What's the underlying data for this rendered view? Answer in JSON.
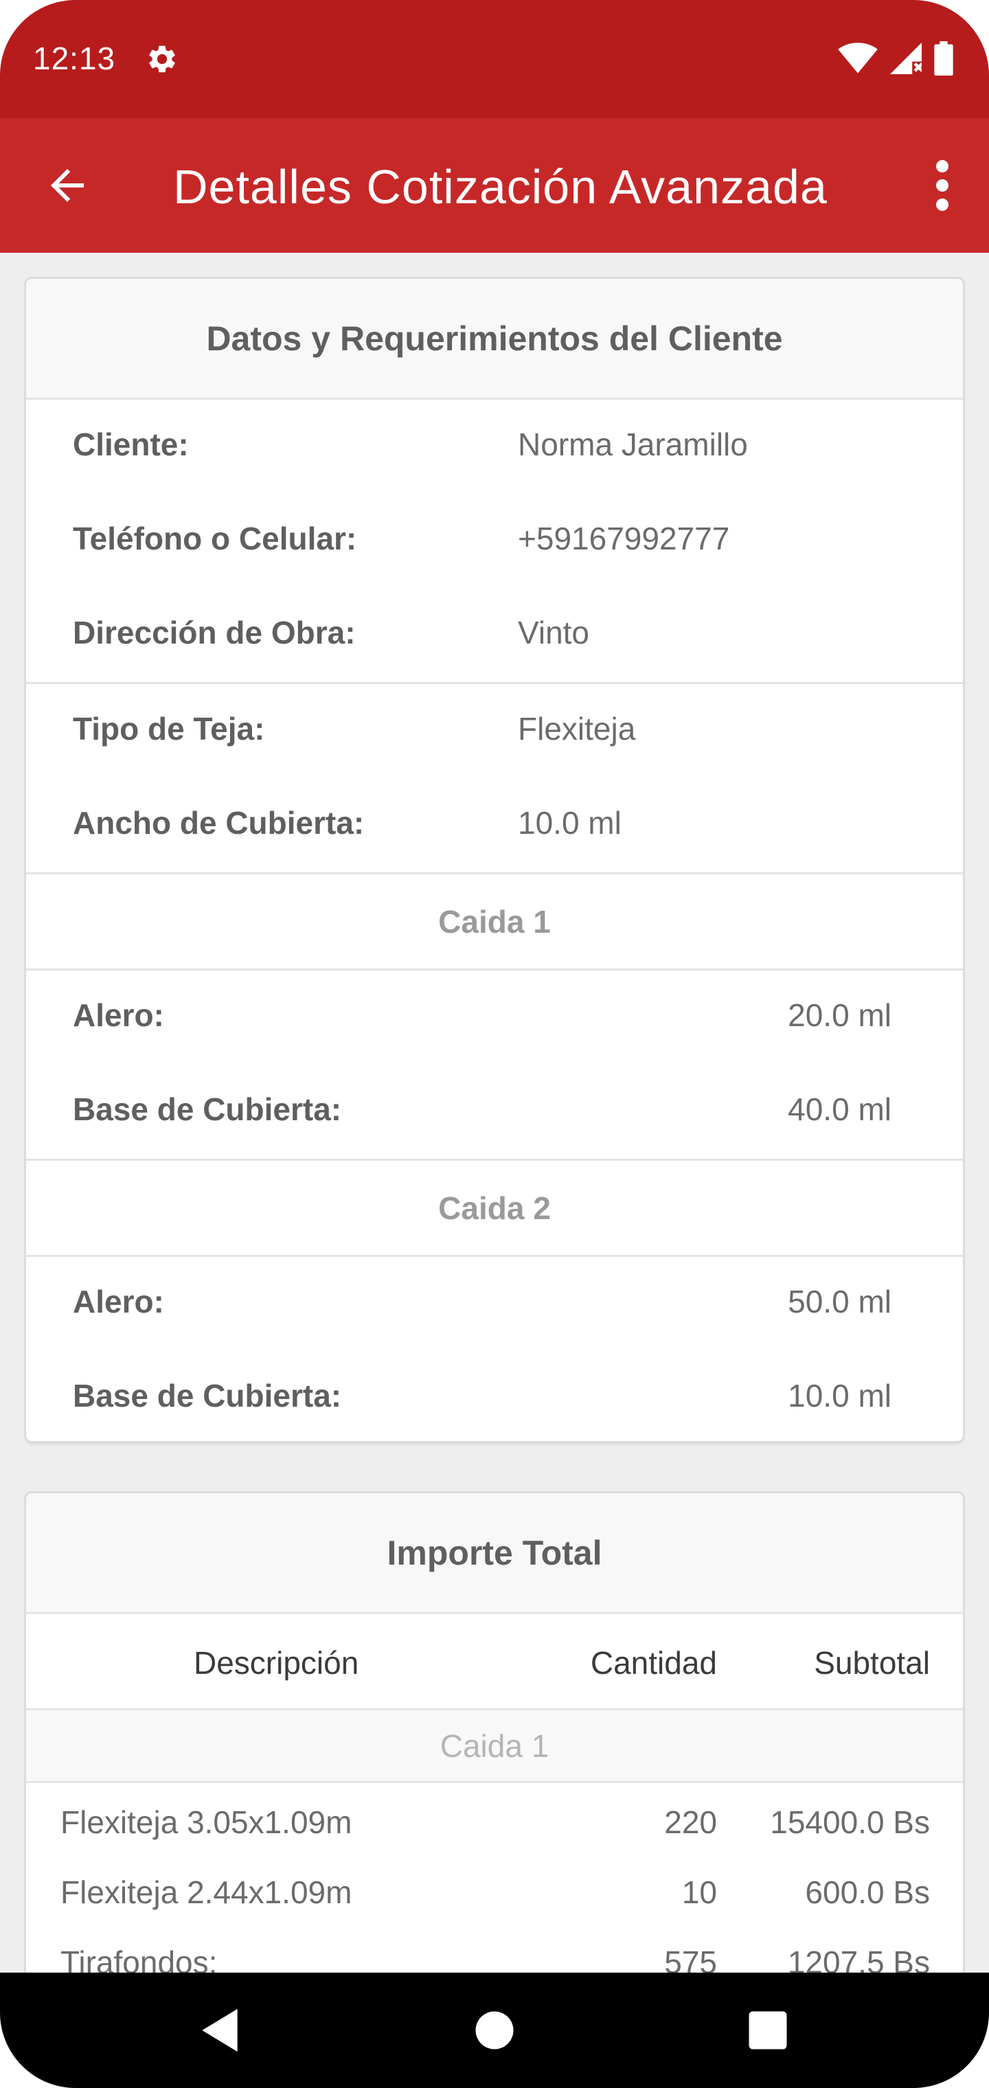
{
  "status_bar": {
    "time": "12:13",
    "icons": [
      "settings-gear-icon",
      "wifi-icon",
      "signal-icon",
      "battery-icon"
    ]
  },
  "app_bar": {
    "title": "Detalles Cotización Avanzada",
    "back_icon": "arrow-back-icon",
    "more_icon": "more-vert-icon"
  },
  "client_card": {
    "header": "Datos y Requerimientos del Cliente",
    "client_info": [
      {
        "label": "Cliente:",
        "value": "Norma Jaramillo"
      },
      {
        "label": "Teléfono o Celular:",
        "value": "+59167992777"
      },
      {
        "label": "Dirección de Obra:",
        "value": "Vinto"
      }
    ],
    "roof_info": [
      {
        "label": "Tipo de Teja:",
        "value": "Flexiteja"
      },
      {
        "label": "Ancho de Cubierta:",
        "value": "10.0 ml"
      }
    ],
    "caidas": [
      {
        "title": "Caida 1",
        "rows": [
          {
            "label": "Alero:",
            "value": "20.0 ml"
          },
          {
            "label": "Base de Cubierta:",
            "value": "40.0 ml"
          }
        ]
      },
      {
        "title": "Caida 2",
        "rows": [
          {
            "label": "Alero:",
            "value": "50.0 ml"
          },
          {
            "label": "Base de Cubierta:",
            "value": "10.0 ml"
          }
        ]
      }
    ]
  },
  "total_card": {
    "header": "Importe Total",
    "columns": {
      "description": "Descripción",
      "quantity": "Cantidad",
      "subtotal": "Subtotal"
    },
    "section": "Caida 1",
    "rows": [
      {
        "description": "Flexiteja 3.05x1.09m",
        "quantity": "220",
        "subtotal": "15400.0 Bs"
      },
      {
        "description": "Flexiteja 2.44x1.09m",
        "quantity": "10",
        "subtotal": "600.0 Bs"
      },
      {
        "description": "Tirafondos:",
        "quantity": "575",
        "subtotal": "1207.5 Bs"
      }
    ]
  },
  "nav_bar": {
    "icons": [
      "nav-back-icon",
      "nav-home-icon",
      "nav-recents-icon"
    ]
  },
  "colors": {
    "status_bar": "#b71c1c",
    "app_bar": "#c62828",
    "background": "#eeeeee"
  }
}
